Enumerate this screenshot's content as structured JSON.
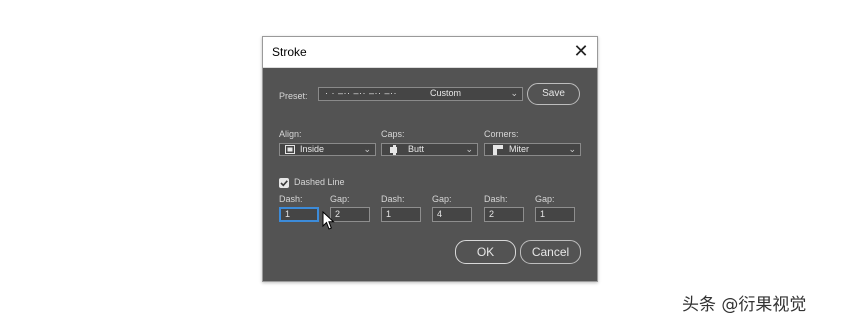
{
  "dialog": {
    "title": "Stroke",
    "close_icon": "close-icon"
  },
  "preset": {
    "label": "Preset:",
    "value_pattern": "· ·  –··  –··  –··  –··",
    "value": "Custom",
    "save_label": "Save"
  },
  "align": {
    "label": "Align:",
    "value": "Inside",
    "icon": "align-inside-icon"
  },
  "caps": {
    "label": "Caps:",
    "value": "Butt",
    "icon": "butt-cap-icon"
  },
  "corners": {
    "label": "Corners:",
    "value": "Miter",
    "icon": "miter-join-icon"
  },
  "dashed": {
    "checkbox_checked": true,
    "label": "Dashed Line",
    "fields": [
      {
        "label": "Dash:",
        "value": "1"
      },
      {
        "label": "Gap:",
        "value": "2"
      },
      {
        "label": "Dash:",
        "value": "1"
      },
      {
        "label": "Gap:",
        "value": "4"
      },
      {
        "label": "Dash:",
        "value": "2"
      },
      {
        "label": "Gap:",
        "value": "1"
      }
    ]
  },
  "buttons": {
    "ok_label": "OK",
    "cancel_label": "Cancel"
  },
  "watermark": "头条 @衍果视觉",
  "colors": {
    "panel": "#535353",
    "field": "#454545",
    "focus": "#3c8bd9"
  }
}
